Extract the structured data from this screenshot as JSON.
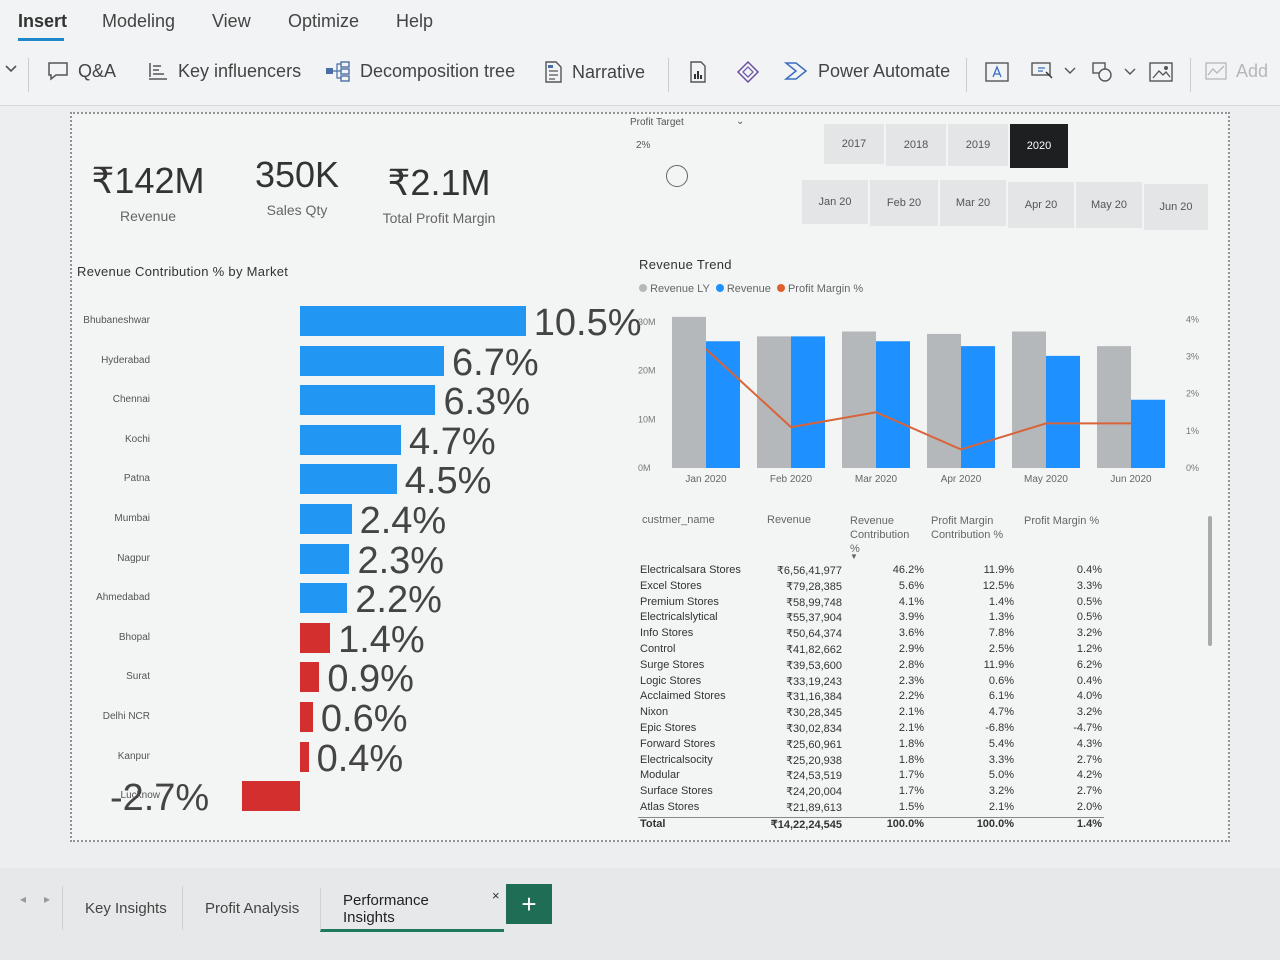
{
  "menu": [
    "Insert",
    "Modeling",
    "View",
    "Optimize",
    "Help"
  ],
  "ribbon": {
    "qa": "Q&A",
    "key_influencers": "Key influencers",
    "decomposition_tree": "Decomposition tree",
    "narrative": "Narrative",
    "power_automate": "Power Automate",
    "add": "Add"
  },
  "kpis": [
    {
      "value": "₹142M",
      "label": "Revenue"
    },
    {
      "value": "350K",
      "label": "Sales Qty"
    },
    {
      "value": "₹2.1M",
      "label": "Total Profit Margin"
    }
  ],
  "slicer": {
    "title": "Profit Target",
    "value": "2%"
  },
  "years": [
    "2017",
    "2018",
    "2019",
    "2020"
  ],
  "selected_year": "2020",
  "months": [
    "Jan 20",
    "Feb 20",
    "Mar 20",
    "Apr 20",
    "May 20",
    "Jun 20"
  ],
  "bar_title": "Revenue Contribution % by Market",
  "line_title": "Revenue Trend",
  "legend": [
    {
      "label": "Revenue LY",
      "color": "#b5b8ba"
    },
    {
      "label": "Revenue",
      "color": "#1e90ff"
    },
    {
      "label": "Profit Margin %",
      "color": "#e0612d"
    }
  ],
  "colors": {
    "positive": "#2196f3",
    "negative": "#d32f2f",
    "revenue_ly": "#b5b8ba",
    "revenue": "#1e90ff",
    "margin": "#d7643a"
  },
  "chart_data": [
    {
      "type": "bar",
      "orientation": "horizontal",
      "title": "Revenue Contribution % by Market",
      "categories": [
        "Bhubaneshwar",
        "Hyderabad",
        "Chennai",
        "Kochi",
        "Patna",
        "Mumbai",
        "Nagpur",
        "Ahmedabad",
        "Bhopal",
        "Surat",
        "Delhi NCR",
        "Kanpur",
        "Lucknow"
      ],
      "values": [
        10.5,
        6.7,
        6.3,
        4.7,
        4.5,
        2.4,
        2.3,
        2.2,
        1.4,
        0.9,
        0.6,
        0.4,
        -2.7
      ],
      "labels": [
        "10.5%",
        "6.7%",
        "6.3%",
        "4.7%",
        "4.5%",
        "2.4%",
        "2.3%",
        "2.2%",
        "1.4%",
        "0.9%",
        "0.6%",
        "0.4%",
        "-2.7%"
      ]
    },
    {
      "type": "bar",
      "title": "Revenue Trend",
      "categories": [
        "Jan 2020",
        "Feb 2020",
        "Mar 2020",
        "Apr 2020",
        "May 2020",
        "Jun 2020"
      ],
      "y_ticks": [
        "30M",
        "20M",
        "10M",
        "0M"
      ],
      "y2_ticks": [
        "4%",
        "3%",
        "2%",
        "1%",
        "0%"
      ],
      "ylim": [
        0,
        32
      ],
      "y2lim": [
        0,
        4.2
      ],
      "series": [
        {
          "name": "Revenue LY",
          "type": "bar",
          "values": [
            31,
            27,
            28,
            27.5,
            28,
            25
          ]
        },
        {
          "name": "Revenue",
          "type": "bar",
          "values": [
            26,
            27,
            26,
            25,
            23,
            14
          ]
        },
        {
          "name": "Profit Margin %",
          "type": "line",
          "values": [
            3.2,
            1.1,
            1.5,
            0.5,
            1.2,
            1.2
          ]
        }
      ]
    }
  ],
  "table": {
    "headers": [
      "custmer_name",
      "Revenue",
      "Revenue Contribution %",
      "Profit Margin Contribution %",
      "Profit Margin %"
    ],
    "rows": [
      [
        "Electricalsara Stores",
        "₹6,56,41,977",
        "46.2%",
        "11.9%",
        "0.4%"
      ],
      [
        "Excel Stores",
        "₹79,28,385",
        "5.6%",
        "12.5%",
        "3.3%"
      ],
      [
        "Premium Stores",
        "₹58,99,748",
        "4.1%",
        "1.4%",
        "0.5%"
      ],
      [
        "Electricalslytical",
        "₹55,37,904",
        "3.9%",
        "1.3%",
        "0.5%"
      ],
      [
        "Info Stores",
        "₹50,64,374",
        "3.6%",
        "7.8%",
        "3.2%"
      ],
      [
        "Control",
        "₹41,82,662",
        "2.9%",
        "2.5%",
        "1.2%"
      ],
      [
        "Surge Stores",
        "₹39,53,600",
        "2.8%",
        "11.9%",
        "6.2%"
      ],
      [
        "Logic Stores",
        "₹33,19,243",
        "2.3%",
        "0.6%",
        "0.4%"
      ],
      [
        "Acclaimed Stores",
        "₹31,16,384",
        "2.2%",
        "6.1%",
        "4.0%"
      ],
      [
        "Nixon",
        "₹30,28,345",
        "2.1%",
        "4.7%",
        "3.2%"
      ],
      [
        "Epic Stores",
        "₹30,02,834",
        "2.1%",
        "-6.8%",
        "-4.7%"
      ],
      [
        "Forward Stores",
        "₹25,60,961",
        "1.8%",
        "5.4%",
        "4.3%"
      ],
      [
        "Electricalsocity",
        "₹25,20,938",
        "1.8%",
        "3.3%",
        "2.7%"
      ],
      [
        "Modular",
        "₹24,53,519",
        "1.7%",
        "5.0%",
        "4.2%"
      ],
      [
        "Surface Stores",
        "₹24,20,004",
        "1.7%",
        "3.2%",
        "2.7%"
      ],
      [
        "Atlas Stores",
        "₹21,89,613",
        "1.5%",
        "2.1%",
        "2.0%"
      ]
    ],
    "total": [
      "Total",
      "₹14,22,24,545",
      "100.0%",
      "100.0%",
      "1.4%"
    ]
  },
  "tabs": [
    "Key Insights",
    "Profit Analysis",
    "Performance Insights"
  ],
  "active_tab": "Performance Insights",
  "tab_close": "×",
  "add_tab": "+"
}
